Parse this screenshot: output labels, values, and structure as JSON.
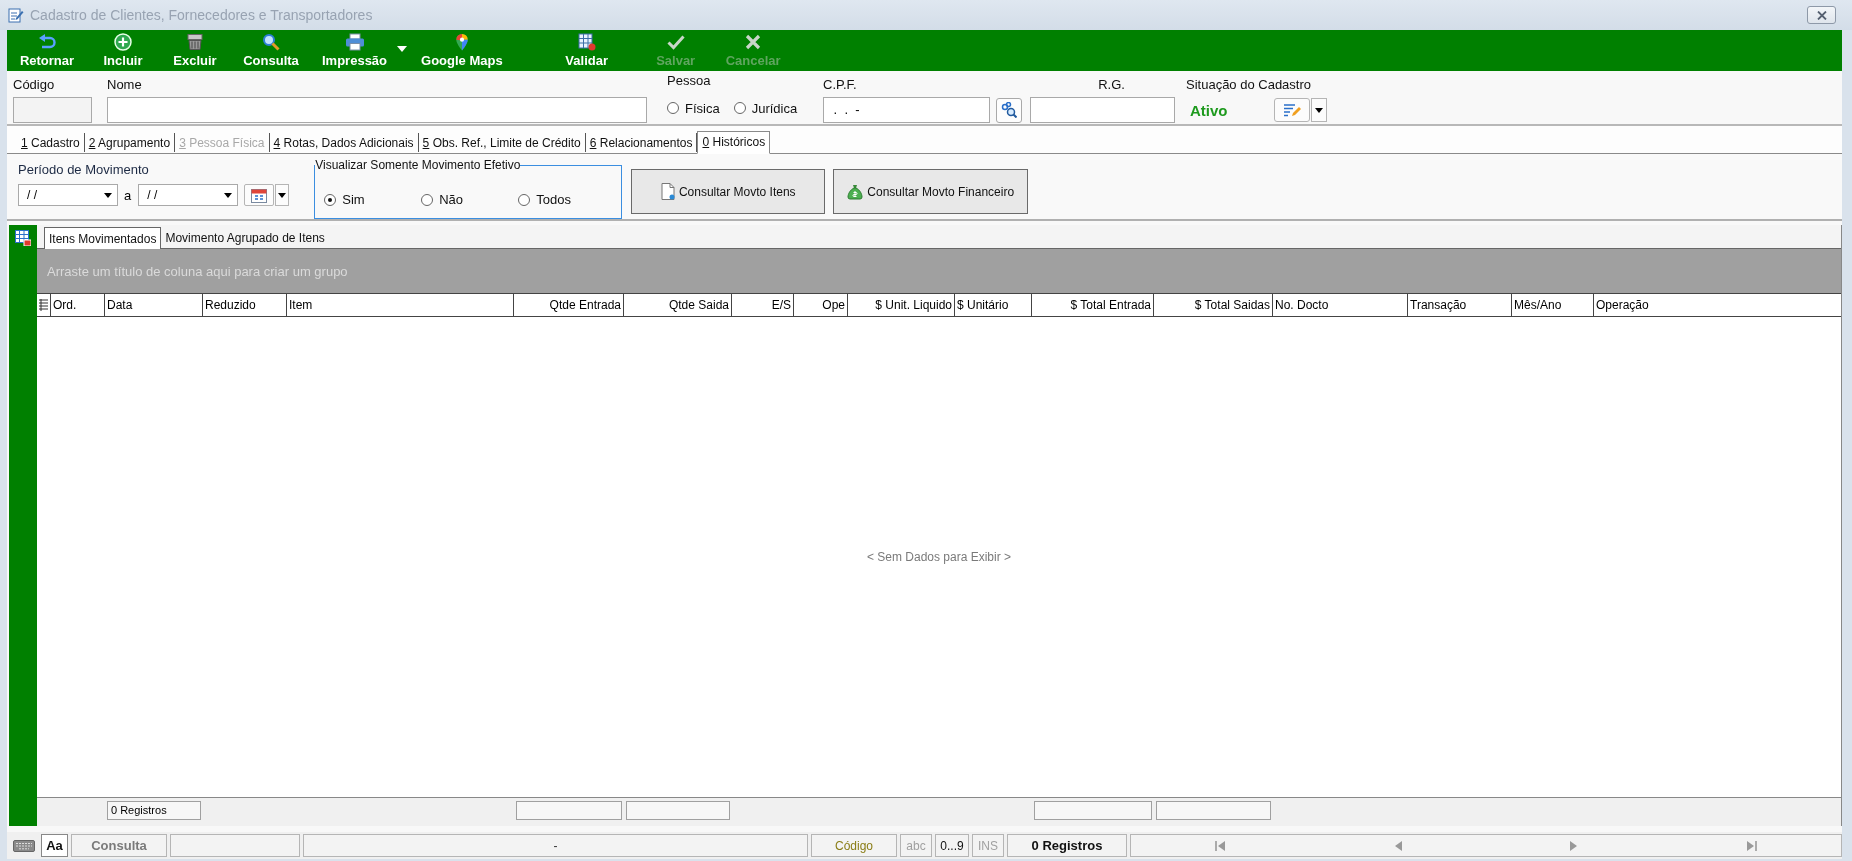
{
  "window": {
    "title": "Cadastro de Clientes, Fornecedores e Transportadores"
  },
  "toolbar": [
    {
      "label": "Retornar",
      "disabled": false,
      "menu": false
    },
    {
      "label": "Incluir",
      "disabled": false,
      "menu": false
    },
    {
      "label": "Excluir",
      "disabled": false,
      "menu": false
    },
    {
      "label": "Consulta",
      "disabled": false,
      "menu": false
    },
    {
      "label": "Impressão",
      "disabled": false,
      "menu": true
    },
    {
      "label": "Google Maps",
      "disabled": false,
      "menu": false
    },
    {
      "label": "Validar",
      "disabled": false,
      "menu": false
    },
    {
      "label": "Salvar",
      "disabled": true,
      "menu": false
    },
    {
      "label": "Cancelar",
      "disabled": true,
      "menu": false
    }
  ],
  "form": {
    "codigo": {
      "label": "Código",
      "readonly": true
    },
    "nome": {
      "label": "Nome"
    },
    "pessoa": {
      "label": "Pessoa",
      "options": [
        {
          "label": "Física",
          "selected": false
        },
        {
          "label": "Jurídica",
          "selected": false
        }
      ]
    },
    "cpf": {
      "label": "C.P.F.",
      "value": " .  .  -"
    },
    "rg": {
      "label": "R.G."
    },
    "situacao": {
      "label": "Situação do Cadastro",
      "value": "Ativo"
    }
  },
  "tabs": [
    {
      "key": "1",
      "label": "Cadastro",
      "selected": false,
      "disabled": false
    },
    {
      "key": "2",
      "label": "Agrupamento",
      "selected": false,
      "disabled": false
    },
    {
      "key": "3",
      "label": "Pessoa Física",
      "selected": false,
      "disabled": true
    },
    {
      "key": "4",
      "label": "Rotas, Dados Adicionais",
      "selected": false,
      "disabled": false
    },
    {
      "key": "5",
      "label": "Obs. Ref., Limite de Crédito",
      "selected": false,
      "disabled": false
    },
    {
      "key": "6",
      "label": "Relacionamentos",
      "selected": false,
      "disabled": false
    },
    {
      "key": "0",
      "label": "Históricos",
      "selected": true,
      "disabled": false
    }
  ],
  "period": {
    "label": "Período de Movimento",
    "from": "/ /",
    "separator": "a",
    "to": "/ /"
  },
  "filter": {
    "title": "Visualizar Somente Movimento Efetivo",
    "options": [
      {
        "label": "Sim",
        "selected": true
      },
      {
        "label": "Não",
        "selected": false
      },
      {
        "label": "Todos",
        "selected": false
      }
    ]
  },
  "actions": [
    {
      "label": "Consultar Movto Itens"
    },
    {
      "label": "Consultar Movto Financeiro"
    }
  ],
  "grid": {
    "tabs": [
      {
        "label": "Itens Movimentados",
        "selected": true
      },
      {
        "label": "Movimento Agrupado de Itens",
        "selected": false
      }
    ],
    "group_hint": "Arraste um título de coluna aqui para criar um grupo",
    "columns": [
      {
        "label": "Ord.",
        "align_right": false,
        "footer": false
      },
      {
        "label": "Data",
        "align_right": false,
        "footer": true,
        "footer_text": "0 Registros"
      },
      {
        "label": "Reduzido",
        "align_right": false,
        "footer": false
      },
      {
        "label": "Item",
        "align_right": false,
        "footer": false
      },
      {
        "label": "Qtde Entrada",
        "align_right": true,
        "footer": true
      },
      {
        "label": "Qtde Saida",
        "align_right": true,
        "footer": true
      },
      {
        "label": "E/S",
        "align_right": true,
        "footer": false
      },
      {
        "label": "Ope",
        "align_right": true,
        "footer": false
      },
      {
        "label": "$ Unit. Liquido",
        "align_right": true,
        "footer": false
      },
      {
        "label": "$ Unitário",
        "align_right": false,
        "footer": false
      },
      {
        "label": "$ Total Entrada",
        "align_right": true,
        "footer": true
      },
      {
        "label": "$ Total Saidas",
        "align_right": true,
        "footer": true
      },
      {
        "label": "No. Docto",
        "align_right": false,
        "footer": false
      },
      {
        "label": "Transação",
        "align_right": false,
        "footer": false
      },
      {
        "label": "Mês/Ano",
        "align_right": false,
        "footer": false
      },
      {
        "label": "Operação",
        "align_right": false,
        "footer": false
      }
    ],
    "empty_text": "< Sem Dados para Exibir >"
  },
  "status_bar": {
    "font_button": "Aa",
    "mode": "Consulta",
    "value": "-",
    "field": "Código",
    "indicators": [
      {
        "label": "abc",
        "on": false
      },
      {
        "label": "0...9",
        "on": true
      },
      {
        "label": "INS",
        "on": false
      }
    ],
    "count": "0 Registros"
  }
}
